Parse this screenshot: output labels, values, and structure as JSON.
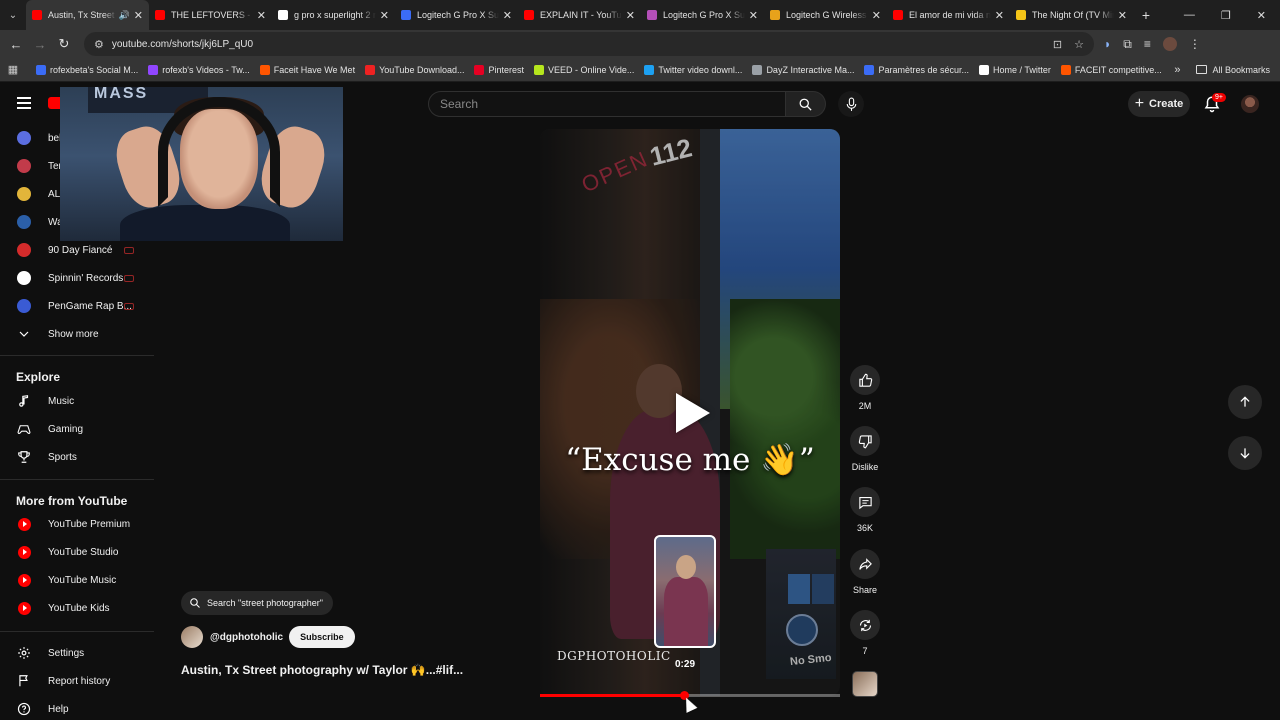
{
  "browser": {
    "tabs": [
      {
        "title": "Austin, Tx Street p",
        "active": true,
        "favicon_color": "#ff0000",
        "audio": true
      },
      {
        "title": "THE LEFTOVERS - Se",
        "favicon_color": "#ff0000"
      },
      {
        "title": "g pro x superlight 2 n",
        "favicon_color": "#ffffff"
      },
      {
        "title": "Logitech G Pro X Sup",
        "favicon_color": "#3b6cf6"
      },
      {
        "title": "EXPLAIN IT - YouTub",
        "favicon_color": "#ff0000"
      },
      {
        "title": "Logitech G Pro X Sup",
        "favicon_color": "#b44fb8"
      },
      {
        "title": "Logitech G Wireless (",
        "favicon_color": "#e7a21b"
      },
      {
        "title": "El amor de mi vida n",
        "favicon_color": "#ff0000"
      },
      {
        "title": "The Night Of (TV Min",
        "favicon_color": "#f5c518"
      }
    ],
    "url": "youtube.com/shorts/jkj6LP_qU0",
    "bookmarks": [
      {
        "label": "rofexbeta's Social M...",
        "color": "#3b6cf6"
      },
      {
        "label": "rofexb's Videos - Tw...",
        "color": "#9146ff"
      },
      {
        "label": "Faceit Have We Met",
        "color": "#ff5500"
      },
      {
        "label": "YouTube Download...",
        "color": "#e22"
      },
      {
        "label": "Pinterest",
        "color": "#e60023"
      },
      {
        "label": "VEED - Online Vide...",
        "color": "#b5e61d"
      },
      {
        "label": "Twitter video downl...",
        "color": "#1da1f2"
      },
      {
        "label": "DayZ Interactive Ma...",
        "color": "#9aa0a6"
      },
      {
        "label": "Paramètres de sécur...",
        "color": "#3b6cf6"
      },
      {
        "label": "Home / Twitter",
        "color": "#ffffff"
      },
      {
        "label": "FACEIT competitive...",
        "color": "#ff5500"
      }
    ],
    "all_bookmarks": "All Bookmarks"
  },
  "masthead": {
    "search_placeholder": "Search",
    "create_label": "Create",
    "notification_badge": "9+"
  },
  "sidebar": {
    "channels": [
      {
        "label": "",
        "color": "#5b6ee1"
      },
      {
        "label": "",
        "color": "#c23b4a"
      },
      {
        "label": "",
        "color": "#e2b53a"
      },
      {
        "label": "",
        "color": "#2b5fa8"
      },
      {
        "label": "90 Day Fiancé",
        "color": "#d42b2b"
      },
      {
        "label": "Spinnin' Records",
        "color": "#ffffff"
      },
      {
        "label": "PenGame Rap B...",
        "color": "#3a5bd4"
      }
    ],
    "partial_labels": [
      "bel",
      "Ter",
      "AL",
      "Wa"
    ],
    "show_more": "Show more",
    "explore_heading": "Explore",
    "explore": [
      {
        "label": "Music",
        "icon": "music-note-icon"
      },
      {
        "label": "Gaming",
        "icon": "gamepad-icon"
      },
      {
        "label": "Sports",
        "icon": "trophy-icon"
      }
    ],
    "more_heading": "More from YouTube",
    "more": [
      {
        "label": "YouTube Premium"
      },
      {
        "label": "YouTube Studio"
      },
      {
        "label": "YouTube Music"
      },
      {
        "label": "YouTube Kids"
      }
    ],
    "footer": [
      {
        "label": "Settings",
        "icon": "gear-icon"
      },
      {
        "label": "Report history",
        "icon": "flag-icon"
      },
      {
        "label": "Help",
        "icon": "help-icon"
      }
    ]
  },
  "webcam": {
    "banner_text": "MASS"
  },
  "short": {
    "caption": "“Excuse me 👋”",
    "watermark": "DGPHOTOHOLIC",
    "sign_open": "OPEN",
    "sign_number": "112",
    "sign_no_smoking": "No Smo",
    "progress": 0.48,
    "preview_time": "0:29"
  },
  "actions": {
    "likes": "2M",
    "dislike": "Dislike",
    "comments": "36K",
    "share": "Share",
    "remix": "7"
  },
  "meta": {
    "search_chip": "Search \"street photographer\"",
    "channel": "@dgphotoholic",
    "subscribe": "Subscribe",
    "title": "Austin, Tx Street photography w/ Taylor 🙌...#lif..."
  }
}
